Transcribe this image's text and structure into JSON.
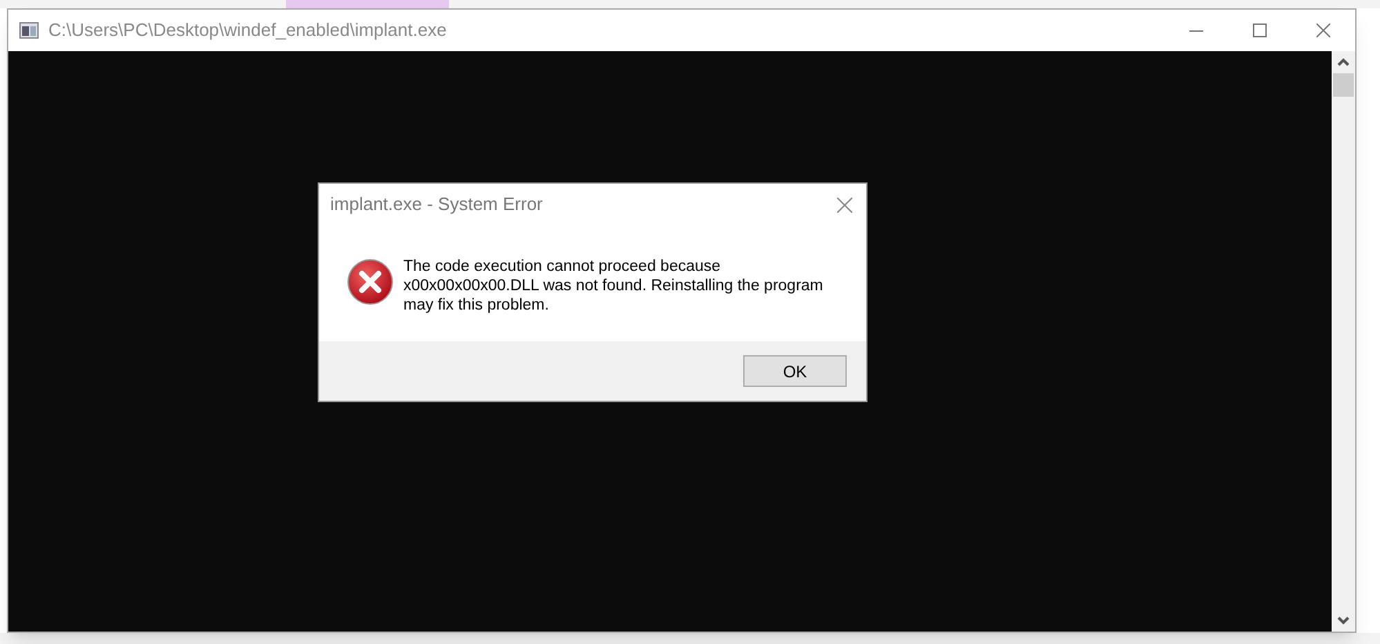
{
  "console_window": {
    "title": "C:\\Users\\PC\\Desktop\\windef_enabled\\implant.exe"
  },
  "dialog": {
    "title": "implant.exe - System Error",
    "message": "The code execution cannot proceed because x00x00x00x00.DLL was not found. Reinstalling the program may fix this problem.",
    "buttons": [
      "OK"
    ]
  }
}
